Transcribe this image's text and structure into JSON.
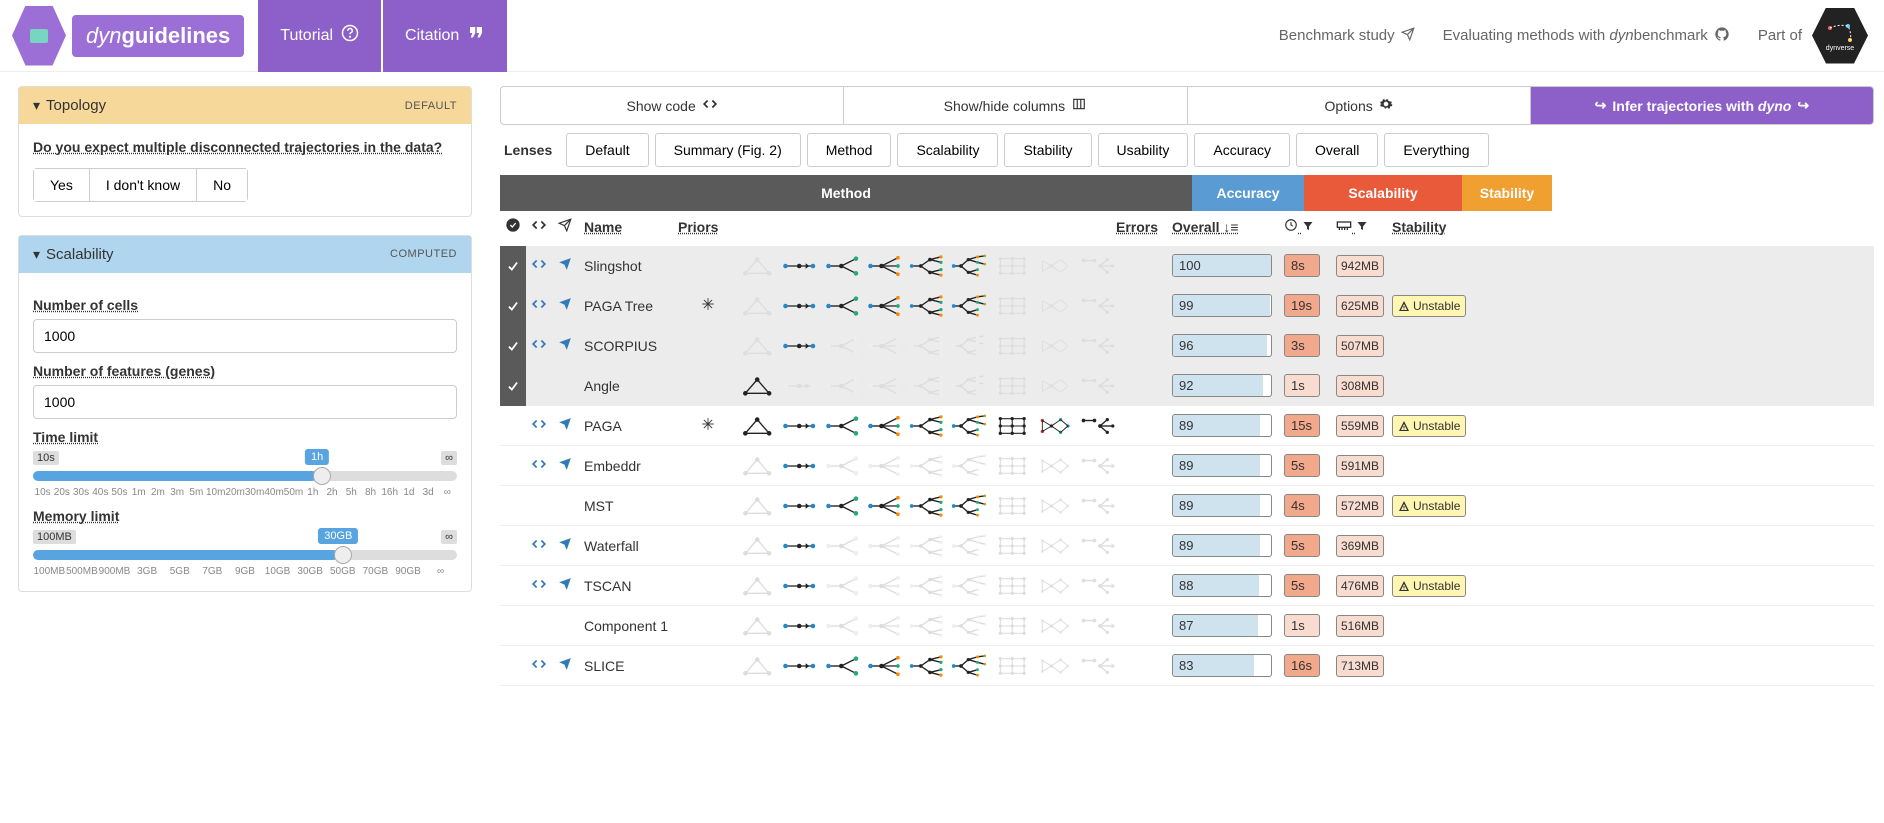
{
  "header": {
    "logo_prefix": "dyn",
    "logo_suffix": "guidelines",
    "tutorial": "Tutorial",
    "citation": "Citation",
    "benchmark": "Benchmark study",
    "evaluating_pre": "Evaluating methods with ",
    "evaluating_em": "dyn",
    "evaluating_post": "benchmark",
    "partof": "Part of",
    "dynverse": "dynverse"
  },
  "sidebar": {
    "topology": {
      "title": "Topology",
      "tag": "DEFAULT",
      "question": "Do you expect multiple disconnected trajectories in the data?",
      "yes": "Yes",
      "dontknow": "I don't know",
      "no": "No"
    },
    "scalability": {
      "title": "Scalability",
      "tag": "COMPUTED",
      "ncells_label": "Number of cells",
      "ncells_value": "1000",
      "nfeat_label": "Number of features (genes)",
      "nfeat_value": "1000",
      "time_label": "Time limit",
      "time_min": "10s",
      "time_val": "1h",
      "time_max": "∞",
      "time_ticks": [
        "10s",
        "20s",
        "30s",
        "40s",
        "50s",
        "1m",
        "2m",
        "3m",
        "5m",
        "10m",
        "20m",
        "30m",
        "40m",
        "50m",
        "1h",
        "2h",
        "5h",
        "8h",
        "16h",
        "1d",
        "3d",
        "∞"
      ],
      "mem_label": "Memory limit",
      "mem_min": "100MB",
      "mem_val": "30GB",
      "mem_max": "∞",
      "mem_ticks": [
        "100MB",
        "500MB",
        "900MB",
        "3GB",
        "5GB",
        "7GB",
        "9GB",
        "10GB",
        "30GB",
        "50GB",
        "70GB",
        "90GB",
        "∞"
      ]
    }
  },
  "main": {
    "toprow": {
      "showcode": "Show code",
      "showcols": "Show/hide columns",
      "options": "Options",
      "infer_pre": "Infer trajectories with ",
      "infer_em": "dyno"
    },
    "lenses": {
      "label": "Lenses",
      "items": [
        "Default",
        "Summary (Fig. 2)",
        "Method",
        "Scalability",
        "Stability",
        "Usability",
        "Accuracy",
        "Overall",
        "Everything"
      ]
    },
    "catheaders": {
      "method": "Method",
      "accuracy": "Accuracy",
      "scalability": "Scalability",
      "stability": "Stability"
    },
    "colheaders": {
      "name": "Name",
      "priors": "Priors",
      "errors": "Errors",
      "overall": "Overall",
      "stability": "Stability"
    },
    "unstable": "Unstable",
    "rows": [
      {
        "selected": true,
        "code": true,
        "send": true,
        "name": "Slingshot",
        "prior": "",
        "overall": "100",
        "fill": 100,
        "time": "8s",
        "mem": "942MB",
        "unstable": false,
        "topos": [
          0,
          1,
          1,
          1,
          1,
          1,
          0,
          0,
          0
        ]
      },
      {
        "selected": true,
        "code": true,
        "send": true,
        "name": "PAGA Tree",
        "prior": "✳",
        "overall": "99",
        "fill": 99,
        "time": "19s",
        "mem": "625MB",
        "unstable": true,
        "topos": [
          0,
          1,
          1,
          1,
          1,
          1,
          0,
          0,
          0
        ]
      },
      {
        "selected": true,
        "code": true,
        "send": true,
        "name": "SCORPIUS",
        "prior": "",
        "overall": "96",
        "fill": 96,
        "time": "3s",
        "mem": "507MB",
        "unstable": false,
        "topos": [
          0,
          1,
          0,
          0,
          0,
          0,
          0,
          0,
          0
        ]
      },
      {
        "selected": true,
        "code": false,
        "send": false,
        "name": "Angle",
        "prior": "",
        "overall": "92",
        "fill": 92,
        "time": "1s",
        "tlight": true,
        "mem": "308MB",
        "unstable": false,
        "topos": [
          1,
          0,
          0,
          0,
          0,
          0,
          0,
          0,
          0
        ]
      },
      {
        "selected": false,
        "code": true,
        "send": true,
        "name": "PAGA",
        "prior": "✳",
        "overall": "89",
        "fill": 89,
        "time": "15s",
        "mem": "559MB",
        "unstable": true,
        "topos": [
          1,
          1,
          1,
          1,
          1,
          1,
          1,
          1,
          1
        ]
      },
      {
        "selected": false,
        "code": true,
        "send": true,
        "name": "Embeddr",
        "prior": "",
        "overall": "89",
        "fill": 89,
        "time": "5s",
        "mem": "591MB",
        "unstable": false,
        "topos": [
          0,
          1,
          0,
          0,
          0,
          0,
          0,
          0,
          0
        ]
      },
      {
        "selected": false,
        "code": false,
        "send": false,
        "name": "MST",
        "prior": "",
        "overall": "89",
        "fill": 89,
        "time": "4s",
        "mem": "572MB",
        "unstable": true,
        "topos": [
          0,
          1,
          1,
          1,
          1,
          1,
          0,
          0,
          0
        ]
      },
      {
        "selected": false,
        "code": true,
        "send": true,
        "name": "Waterfall",
        "prior": "",
        "overall": "89",
        "fill": 89,
        "time": "5s",
        "mem": "369MB",
        "unstable": false,
        "topos": [
          0,
          1,
          0,
          0,
          0,
          0,
          0,
          0,
          0
        ]
      },
      {
        "selected": false,
        "code": true,
        "send": true,
        "name": "TSCAN",
        "prior": "",
        "overall": "88",
        "fill": 88,
        "time": "5s",
        "mem": "476MB",
        "unstable": true,
        "topos": [
          0,
          1,
          0,
          0,
          0,
          0,
          0,
          0,
          0
        ]
      },
      {
        "selected": false,
        "code": false,
        "send": false,
        "name": "Component 1",
        "prior": "",
        "overall": "87",
        "fill": 87,
        "time": "1s",
        "tlight": true,
        "mem": "516MB",
        "unstable": false,
        "topos": [
          0,
          1,
          0,
          0,
          0,
          0,
          0,
          0,
          0
        ]
      },
      {
        "selected": false,
        "code": true,
        "send": true,
        "name": "SLICE",
        "prior": "",
        "overall": "83",
        "fill": 83,
        "time": "16s",
        "mem": "713MB",
        "unstable": false,
        "topos": [
          0,
          1,
          1,
          1,
          1,
          1,
          0,
          0,
          0
        ]
      }
    ]
  }
}
